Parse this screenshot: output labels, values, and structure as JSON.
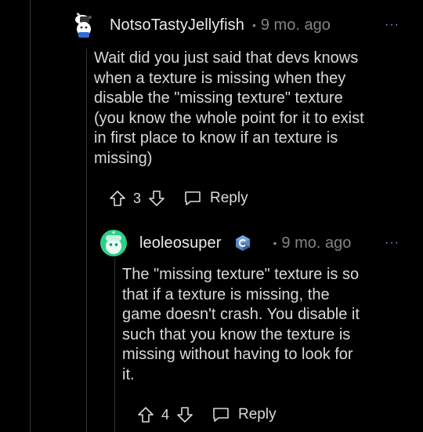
{
  "colors": {
    "background": "#000000",
    "text": "#d7dadc",
    "meta": "#818384",
    "thread_line": "#343536",
    "more_dots": "#7a9dd6"
  },
  "comments": [
    {
      "username": "NotsoTastyJellyfish",
      "separator": "•",
      "time": "9 mo. ago",
      "more_label": "···",
      "avatar_icon": "snoo-avatar-icon",
      "body": "Wait did you just said that devs knows\nwhen a texture is missing when they\ndisable the \"missing texture\" texture\n(you know the whole point for it to exist\nin first place to know if an texture is\nmissing)",
      "votes": "3",
      "reply_label": "Reply"
    },
    {
      "username": "leoleosuper",
      "flair_icon": "c-plus-plus-flair-icon",
      "separator": "•",
      "time": "9 mo. ago",
      "more_label": "···",
      "avatar_icon": "snoo-avatar-icon",
      "body": "The \"missing texture\" texture is so\nthat if a texture is missing, the\ngame doesn't crash. You disable it\nsuch that you know the texture is\nmissing without having to look for\nit.",
      "votes": "4",
      "reply_label": "Reply"
    }
  ]
}
